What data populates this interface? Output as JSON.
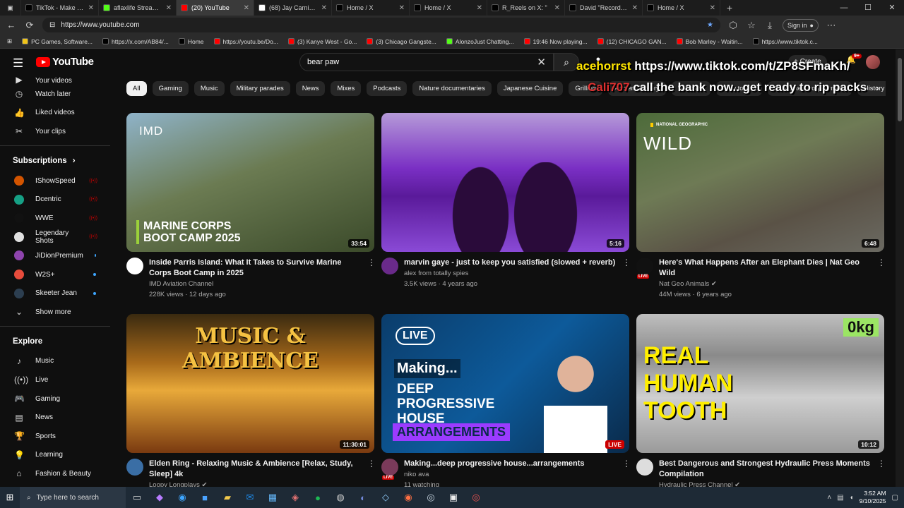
{
  "browser": {
    "tabs": [
      {
        "label": "TikTok - Make Your",
        "color": "#000000"
      },
      {
        "label": "aflaxlife Stream - W",
        "color": "#53fc18"
      },
      {
        "label": "(20) YouTube",
        "color": "#ff0000",
        "active": true
      },
      {
        "label": "(68) Jay Carnicom D",
        "color": "#ffffff"
      },
      {
        "label": "Home / X",
        "color": "#000000"
      },
      {
        "label": "Home / X",
        "color": "#000000"
      },
      {
        "label": "R_Reels on X: \"",
        "color": "#000000"
      },
      {
        "label": "David \"Record Brea",
        "color": "#000000"
      },
      {
        "label": "Home / X",
        "color": "#000000"
      }
    ],
    "url": "https://www.youtube.com",
    "signin_label": "Sign in",
    "bookmarks": [
      {
        "label": "PC Games, Software...",
        "color": "#f0c419"
      },
      {
        "label": "https://x.com/AB84/...",
        "color": "#000000"
      },
      {
        "label": "Home",
        "color": "#000000"
      },
      {
        "label": "https://youtu.be/Do...",
        "color": "#ff0000"
      },
      {
        "label": "(3) Kanye West - Go...",
        "color": "#ff0000"
      },
      {
        "label": "(3) Chicago Gangste...",
        "color": "#ff0000"
      },
      {
        "label": "AlonzoJust Chatting...",
        "color": "#53fc18"
      },
      {
        "label": "19:46 Now playing...",
        "color": "#ff0000"
      },
      {
        "label": "(12) CHICAGO GAN...",
        "color": "#ff0000"
      },
      {
        "label": "Bob Marley - Waitin...",
        "color": "#ff0000"
      },
      {
        "label": "https://www.tiktok.c...",
        "color": "#000000"
      }
    ]
  },
  "youtube": {
    "logo_text": "YouTube",
    "search_value": "bear paw",
    "create_label": "Create",
    "notif_count": "9+",
    "sidebar_top": [
      {
        "label": "Your videos",
        "icon": "play-square-icon"
      },
      {
        "label": "Watch later",
        "icon": "clock-icon"
      },
      {
        "label": "Liked videos",
        "icon": "thumbs-up-icon"
      },
      {
        "label": "Your clips",
        "icon": "scissors-icon"
      }
    ],
    "subscriptions_label": "Subscriptions",
    "subscriptions": [
      {
        "label": "IShowSpeed",
        "color": "#d35400",
        "live": true
      },
      {
        "label": "Dcentric",
        "color": "#16a085",
        "live": true
      },
      {
        "label": "WWE",
        "color": "#111111",
        "live": true
      },
      {
        "label": "Legendary Shots",
        "color": "#e0e0e0",
        "live": true
      },
      {
        "label": "JiDionPremium",
        "color": "#8e44ad",
        "live": false
      },
      {
        "label": "W2S+",
        "color": "#e74c3c",
        "live": false
      },
      {
        "label": "Skeeter Jean",
        "color": "#2c3e50",
        "live": false
      }
    ],
    "show_more_label": "Show more",
    "explore_label": "Explore",
    "explore": [
      {
        "label": "Music",
        "icon": "music-note-icon"
      },
      {
        "label": "Live",
        "icon": "live-icon"
      },
      {
        "label": "Gaming",
        "icon": "gamepad-icon"
      },
      {
        "label": "News",
        "icon": "news-icon"
      },
      {
        "label": "Sports",
        "icon": "trophy-icon"
      },
      {
        "label": "Learning",
        "icon": "lightbulb-icon"
      },
      {
        "label": "Fashion & Beauty",
        "icon": "hanger-icon"
      }
    ],
    "chips": [
      "All",
      "Gaming",
      "Music",
      "Military parades",
      "News",
      "Mixes",
      "Podcasts",
      "Nature documentaries",
      "Japanese Cuisine",
      "Grilling",
      "Ancient History",
      "Watched",
      "New to you",
      "Computer programming",
      "History"
    ],
    "overlay": {
      "line1_user": "acehorrst",
      "line1_text": "https://www.tiktok.com/t/ZP8SFmaKh/",
      "line2_user": "Cali707",
      "line2_text": "call the bank now.. get ready to rip packs"
    },
    "videos": [
      {
        "title": "Inside Parris Island: What It Takes to Survive Marine Corps Boot Camp in 2025",
        "channel": "IMD Aviation Channel",
        "stats": "228K views · 12 days ago",
        "duration": "33:54",
        "thumb_text": "MARINE CORPS\nBOOT CAMP 2025",
        "thumb_badge": "IMD",
        "avatar_color": "#ffffff",
        "live": false
      },
      {
        "title": "marvin gaye - just to keep you satisfied (slowed + reverb)",
        "channel": "alex from totally spies",
        "stats": "3.5K views · 4 years ago",
        "duration": "5:16",
        "thumb_text": "",
        "thumb_badge": "",
        "avatar_color": "#6a2a8a",
        "live": false
      },
      {
        "title": "Here's What Happens After an Elephant Dies | Nat Geo Wild",
        "channel": "Nat Geo Animals",
        "stats": "44M views · 6 years ago",
        "duration": "6:48",
        "thumb_text": "WILD",
        "thumb_badge": "NATIONAL GEOGRAPHIC",
        "avatar_color": "#111111",
        "live": true,
        "verified": true
      },
      {
        "title": "Elden Ring - Relaxing Music & Ambience [Relax, Study, Sleep] 4k",
        "channel": "Loopy Longplays",
        "stats": "",
        "duration": "11:30:01",
        "thumb_text": "MUSIC & AMBIENCE",
        "thumb_badge": "",
        "avatar_color": "#3a6ea5",
        "live": false,
        "verified": true
      },
      {
        "title": "Making...deep progressive house...arrangements",
        "channel": "niko ava",
        "stats": "11 watching",
        "duration": "LIVE",
        "thumb_text": "DEEP\nPROGRESSIVE\nHOUSE",
        "thumb_badge": "Making...",
        "thumb_live": "LIVE",
        "thumb_arr": "ARRANGEMENTS",
        "avatar_color": "#7a3a5a",
        "live": true
      },
      {
        "title": "Best Dangerous and Strongest Hydraulic Press Moments Compilation",
        "channel": "Hydraulic Press Channel",
        "stats": "",
        "duration": "10:12",
        "thumb_text": "REAL\nHUMAN\nTOOTH",
        "thumb_badge": "0kg",
        "avatar_color": "#dddddd",
        "live": false,
        "verified": true
      }
    ]
  },
  "taskbar": {
    "search_placeholder": "Type here to search",
    "time": "3:52 AM",
    "date": "9/10/2025"
  }
}
